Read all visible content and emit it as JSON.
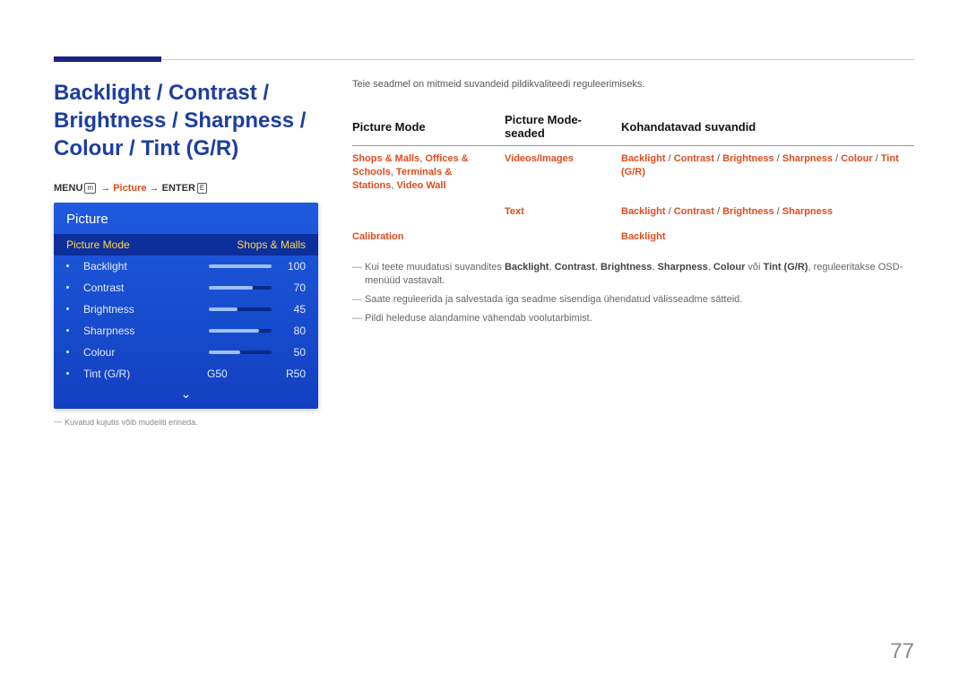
{
  "page_number": "77",
  "section_title": "Backlight / Contrast / Brightness / Sharpness / Colour / Tint (G/R)",
  "menu_path": {
    "menu": "MENU",
    "arrow": "→",
    "picture": "Picture",
    "enter": "ENTER"
  },
  "osd": {
    "title": "Picture",
    "mode_label": "Picture Mode",
    "mode_value": "Shops & Malls",
    "rows": [
      {
        "label": "Backlight",
        "value": "100",
        "pct": 100
      },
      {
        "label": "Contrast",
        "value": "70",
        "pct": 70
      },
      {
        "label": "Brightness",
        "value": "45",
        "pct": 45
      },
      {
        "label": "Sharpness",
        "value": "80",
        "pct": 80
      },
      {
        "label": "Colour",
        "value": "50",
        "pct": 50
      }
    ],
    "tint": {
      "label": "Tint (G/R)",
      "g": "G50",
      "r": "R50"
    }
  },
  "osd_note": "Kuvatud kujutis võib mudeliti erineda.",
  "intro": "Teie seadmel on mitmeid suvandeid pildikvaliteedi reguleerimiseks.",
  "table": {
    "h1": "Picture Mode",
    "h2": "Picture Mode-seaded",
    "h3": "Kohandatavad suvandid",
    "rows": [
      {
        "c1": "Shops & Malls, Offices & Schools, Terminals & Stations, Video Wall",
        "c2": "Videos/Images",
        "c3": "Backlight / Contrast / Brightness / Sharpness / Colour / Tint (G/R)"
      },
      {
        "c1": "",
        "c2": "Text",
        "c3": "Backlight / Contrast / Brightness / Sharpness"
      },
      {
        "c1": "Calibration",
        "c2": "",
        "c3": "Backlight"
      }
    ]
  },
  "notes": {
    "n1_pre": "Kui teete muudatusi suvandites ",
    "n1_b": [
      "Backlight",
      "Contrast",
      "Brightness",
      "Sharpness",
      "Colour"
    ],
    "n1_voi": " või ",
    "n1_last": "Tint (G/R)",
    "n1_post": ", reguleeritakse OSD-menüüd vastavalt.",
    "n2": "Saate reguleerida ja salvestada iga seadme sisendiga ühendatud välisseadme sätteid.",
    "n3": "Pildi heleduse alandamine vähendab voolutarbimist."
  }
}
